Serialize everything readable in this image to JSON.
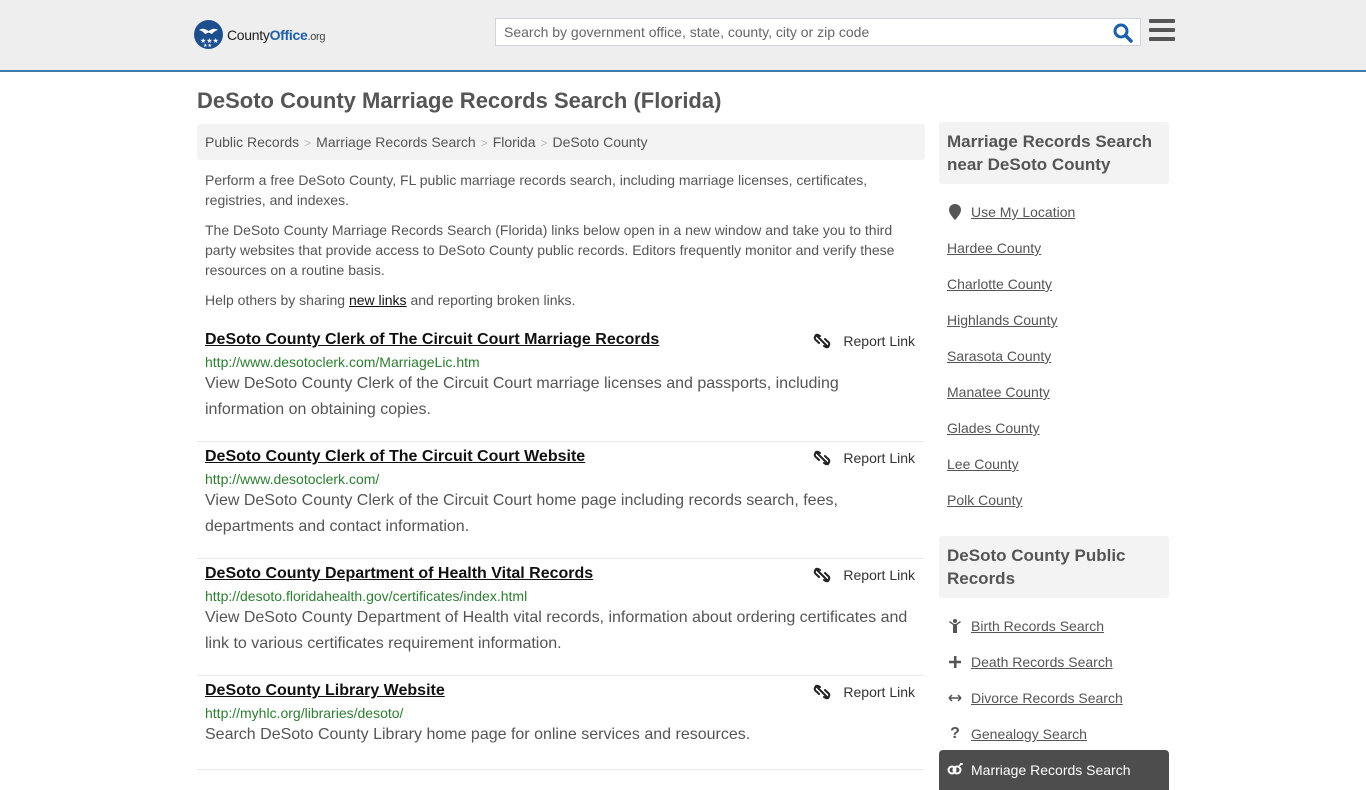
{
  "header": {
    "logo": {
      "name_main": "County",
      "name_accent": "Office",
      "name_suffix": ".org"
    },
    "search": {
      "placeholder": "Search by government office, state, county, city or zip code",
      "value": ""
    },
    "colors": {
      "accent": "#3a7db3",
      "brand": "#1d5ea8",
      "url_green": "#2e7d32"
    }
  },
  "page": {
    "title": "DeSoto County Marriage Records Search (Florida)"
  },
  "breadcrumb": [
    {
      "label": "Public Records"
    },
    {
      "label": "Marriage Records Search"
    },
    {
      "label": "Florida"
    },
    {
      "label": "DeSoto County"
    }
  ],
  "intro": {
    "p1": "Perform a free DeSoto County, FL public marriage records search, including marriage licenses, certificates, registries, and indexes.",
    "p2": "The DeSoto County Marriage Records Search (Florida) links below open in a new window and take you to third party websites that provide access to DeSoto County public records. Editors frequently monitor and verify these resources on a routine basis.",
    "p3_before": "Help others by sharing ",
    "p3_link": "new links",
    "p3_after": " and reporting broken links."
  },
  "results": [
    {
      "title": "DeSoto County Clerk of The Circuit Court Marriage Records",
      "url": "http://www.desotoclerk.com/MarriageLic.htm",
      "description": "View DeSoto County Clerk of the Circuit Court marriage licenses and passports, including information on obtaining copies.",
      "report_label": "Report Link"
    },
    {
      "title": "DeSoto County Clerk of The Circuit Court Website",
      "url": "http://www.desotoclerk.com/",
      "description": "View DeSoto County Clerk of the Circuit Court home page including records search, fees, departments and contact information.",
      "report_label": "Report Link"
    },
    {
      "title": "DeSoto County Department of Health Vital Records",
      "url": "http://desoto.floridahealth.gov/certificates/index.html",
      "description": "View DeSoto County Department of Health vital records, information about ordering certificates and link to various certificates requirement information.",
      "report_label": "Report Link"
    },
    {
      "title": "DeSoto County Library Website",
      "url": "http://myhlc.org/libraries/desoto/",
      "description": "Search DeSoto County Library home page for online services and resources.",
      "report_label": "Report Link"
    }
  ],
  "sidebar": {
    "nearby": {
      "heading": "Marriage Records Search near DeSoto County",
      "use_location": "Use My Location",
      "counties": [
        "Hardee County",
        "Charlotte County",
        "Highlands County",
        "Sarasota County",
        "Manatee County",
        "Glades County",
        "Lee County",
        "Polk County"
      ]
    },
    "public_records": {
      "heading": "DeSoto County Public Records",
      "items": [
        {
          "label": "Birth Records Search",
          "icon": "child-icon"
        },
        {
          "label": "Death Records Search",
          "icon": "plus-icon"
        },
        {
          "label": "Divorce Records Search",
          "icon": "arrows-horizontal-icon"
        },
        {
          "label": "Genealogy Search",
          "icon": "question-icon"
        }
      ],
      "active": {
        "label": "Marriage Records Search",
        "icon": "marriage-symbol-icon"
      }
    }
  }
}
